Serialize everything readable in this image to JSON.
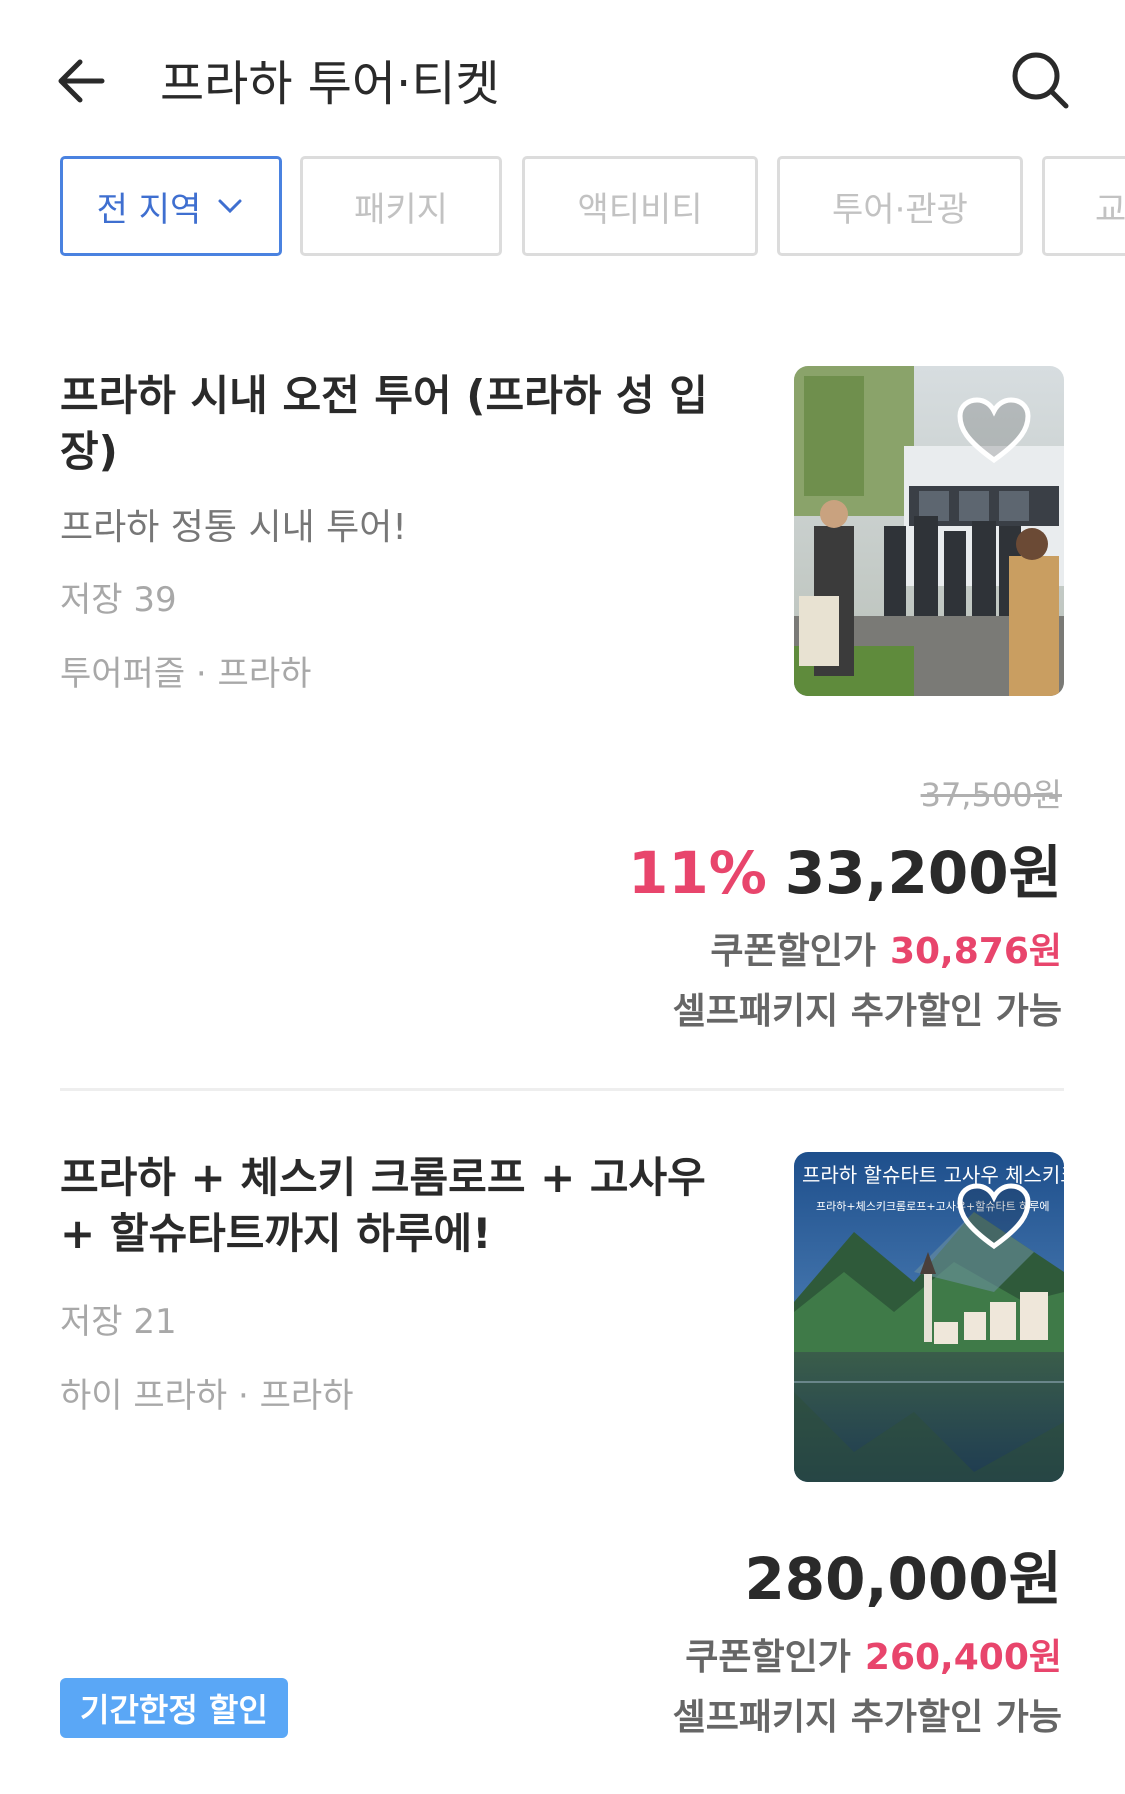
{
  "header": {
    "title": "프라하 투어·티켓",
    "back_icon": "arrow-left-icon",
    "search_icon": "search-icon"
  },
  "filters": [
    {
      "label": "전 지역",
      "active": true
    },
    {
      "label": "패키지",
      "active": false
    },
    {
      "label": "액티비티",
      "active": false
    },
    {
      "label": "투어·관광",
      "active": false
    },
    {
      "label": "교",
      "active": false
    }
  ],
  "products": [
    {
      "title": "프라하 시내 오전 투어 (프라하 성 입장)",
      "title_line1": "프라하 시내 오전 투어 (프라하 성 입",
      "title_line2": "장)",
      "subtitle": "프라하 정통 시내 투어!",
      "saves": "저장 39",
      "provider": "투어퍼즐 · 프라하",
      "original_price": "37,500원",
      "discount": "11%",
      "price": "33,200원",
      "coupon_label": "쿠폰할인가",
      "coupon_price": "30,876원",
      "extra": "셀프패키지 추가할인 가능"
    },
    {
      "title": "프라하 + 체스키 크롬로프 + 고사우 + 할슈타트까지 하루에!",
      "title_line1": "프라하 + 체스키 크롬로프 + 고사우",
      "title_line2": "+ 할슈타트까지 하루에!",
      "saves": "저장 21",
      "provider": "하이 프라하 · 프라하",
      "price": "280,000원",
      "coupon_label": "쿠폰할인가",
      "coupon_price": "260,400원",
      "extra": "셀프패키지 추가할인 가능",
      "badge": "기간한정 할인",
      "image_caption": "프라하 할슈타트 고사우 체스키크롬로프",
      "image_subcaption": "프라하+체스키크롬로프+고사우+할슈타트 하루에"
    }
  ],
  "colors": {
    "accent_blue": "#4a82e0",
    "discount_pink": "#e8456c",
    "badge_blue": "#5aa7f6"
  }
}
